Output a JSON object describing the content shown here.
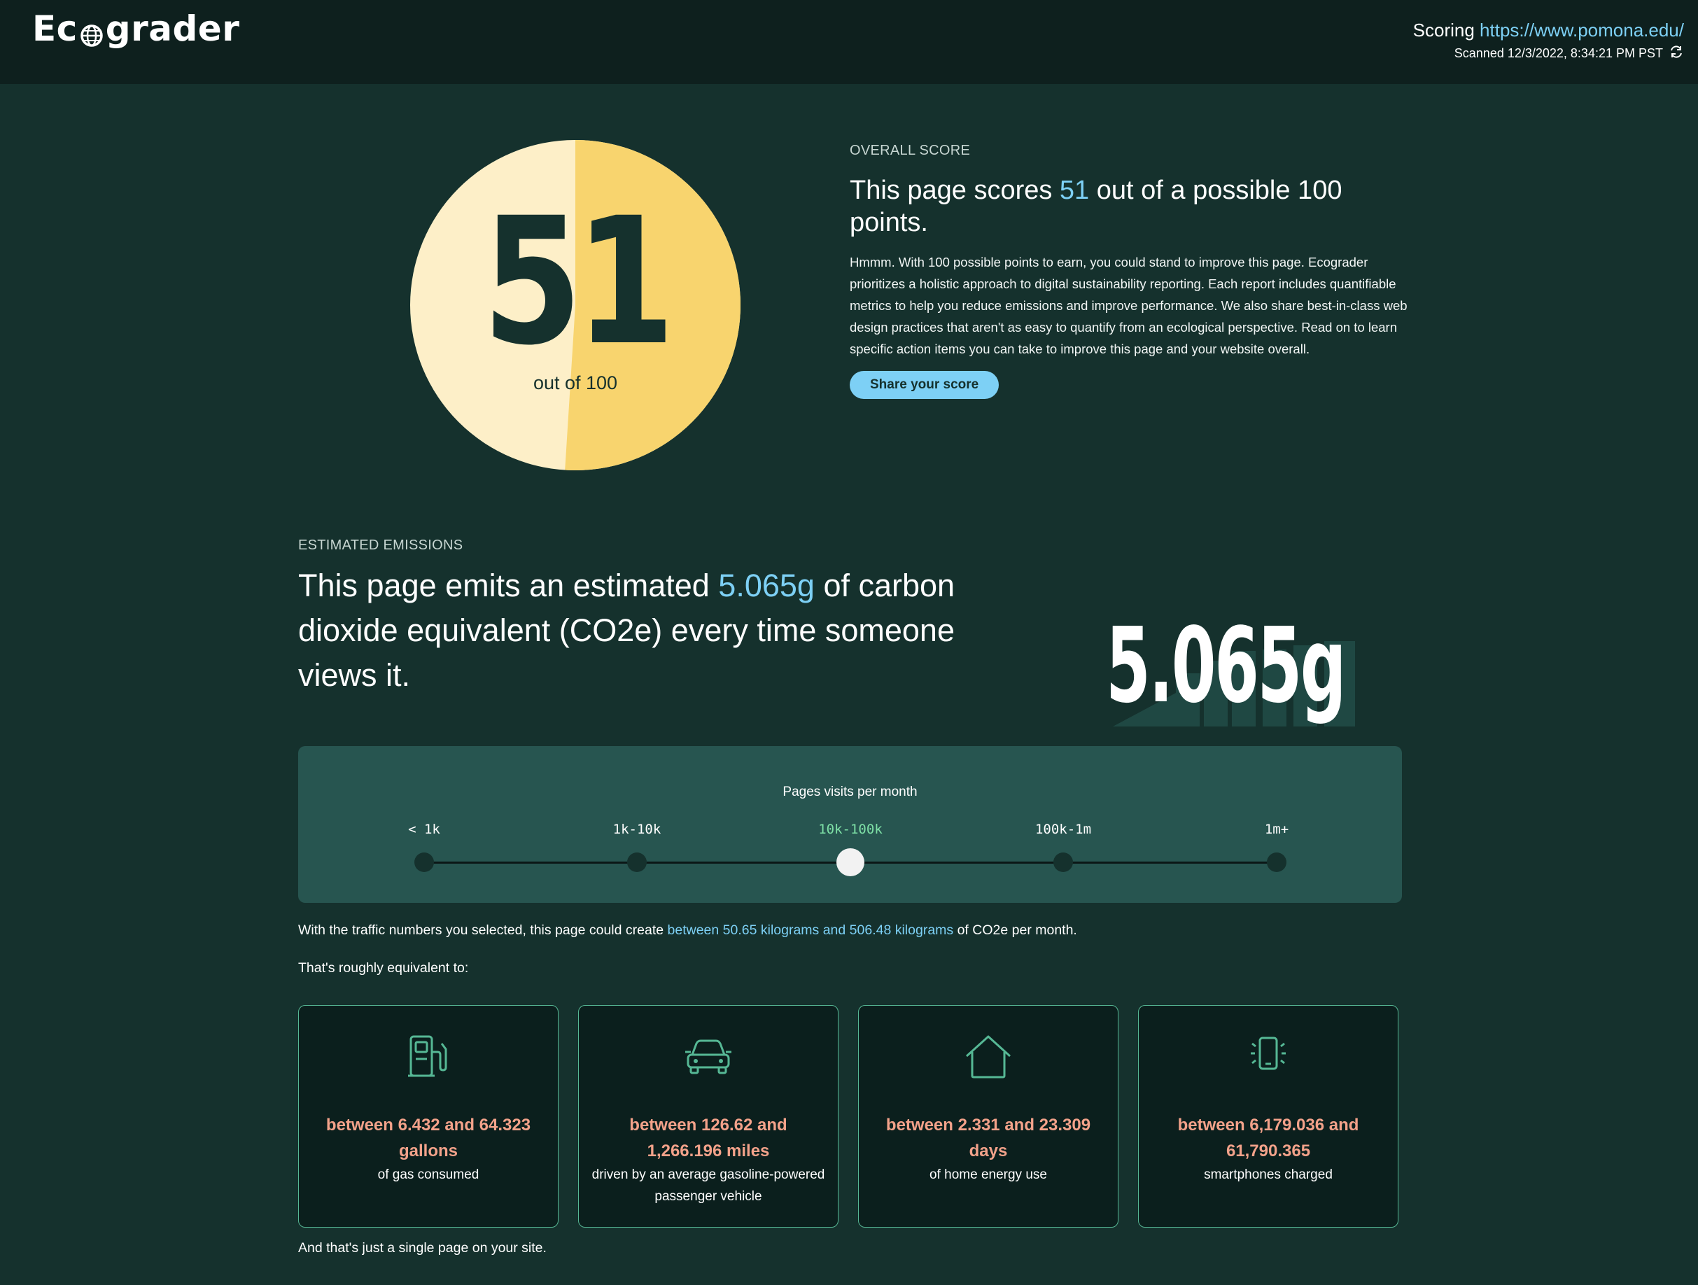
{
  "header": {
    "logo": {
      "before": "Ec",
      "after": "grader"
    },
    "scoring_label": "Scoring",
    "scoring_url": "https://www.pomona.edu/",
    "scanned": "Scanned 12/3/2022, 8:34:21 PM PST"
  },
  "score": {
    "value": 51,
    "value_text": "51",
    "out_of": "out of 100",
    "colors": {
      "light": "#fdefc8",
      "fill": "#f8d46e",
      "text": "#15312d"
    }
  },
  "overall": {
    "kicker": "OVERALL SCORE",
    "headline_pre": "This page scores ",
    "headline_score": "51",
    "headline_post": " out of a possible 100 points.",
    "body": "Hmmm. With 100 possible points to earn, you could stand to improve this page. Ecograder prioritizes a holistic approach to digital sustainability reporting. Each report includes quantifiable metrics to help you reduce emissions and improve performance. We also share best-in-class web design practices that aren't as easy to quantify from an ecological perspective. Read on to learn specific action items you can take to improve this page and your website overall.",
    "share_label": "Share your score"
  },
  "emissions": {
    "kicker": "ESTIMATED EMISSIONS",
    "headline_pre": "This page emits an estimated ",
    "headline_value": "5.065g",
    "headline_post": " of carbon dioxide equivalent (CO2e) every time someone views it.",
    "big_value": "5.065g"
  },
  "traffic": {
    "title": "Pages visits per month",
    "options": [
      "< 1k",
      "1k-10k",
      "10k-100k",
      "100k-1m",
      "1m+"
    ],
    "selected_index": 2
  },
  "result": {
    "pre": "With the traffic numbers you selected, this page could create ",
    "range": "between 50.65 kilograms and 506.48 kilograms",
    "post": " of CO2e per month.",
    "equivalent_intro": "That's roughly equivalent to:"
  },
  "equivalents": [
    {
      "icon": "gas-pump-icon",
      "amount": "between 6.432 and 64.323 gallons",
      "desc": "of gas consumed"
    },
    {
      "icon": "car-icon",
      "amount": "between 126.62 and 1,266.196 miles",
      "desc": "driven by an average gasoline-powered passenger vehicle"
    },
    {
      "icon": "house-icon",
      "amount": "between 2.331 and 23.309 days",
      "desc": "of home energy use"
    },
    {
      "icon": "smartphone-icon",
      "amount": "between 6,179.036 and 61,790.365",
      "desc": "smartphones charged"
    }
  ],
  "footer_note": "And that's just a single page on your site.",
  "colors": {
    "background": "#15312d",
    "topbar": "#0e201e",
    "accent_blue": "#7dd0f5",
    "accent_green": "#56b895",
    "amount_salmon": "#f3a28a",
    "panel": "#275550"
  }
}
